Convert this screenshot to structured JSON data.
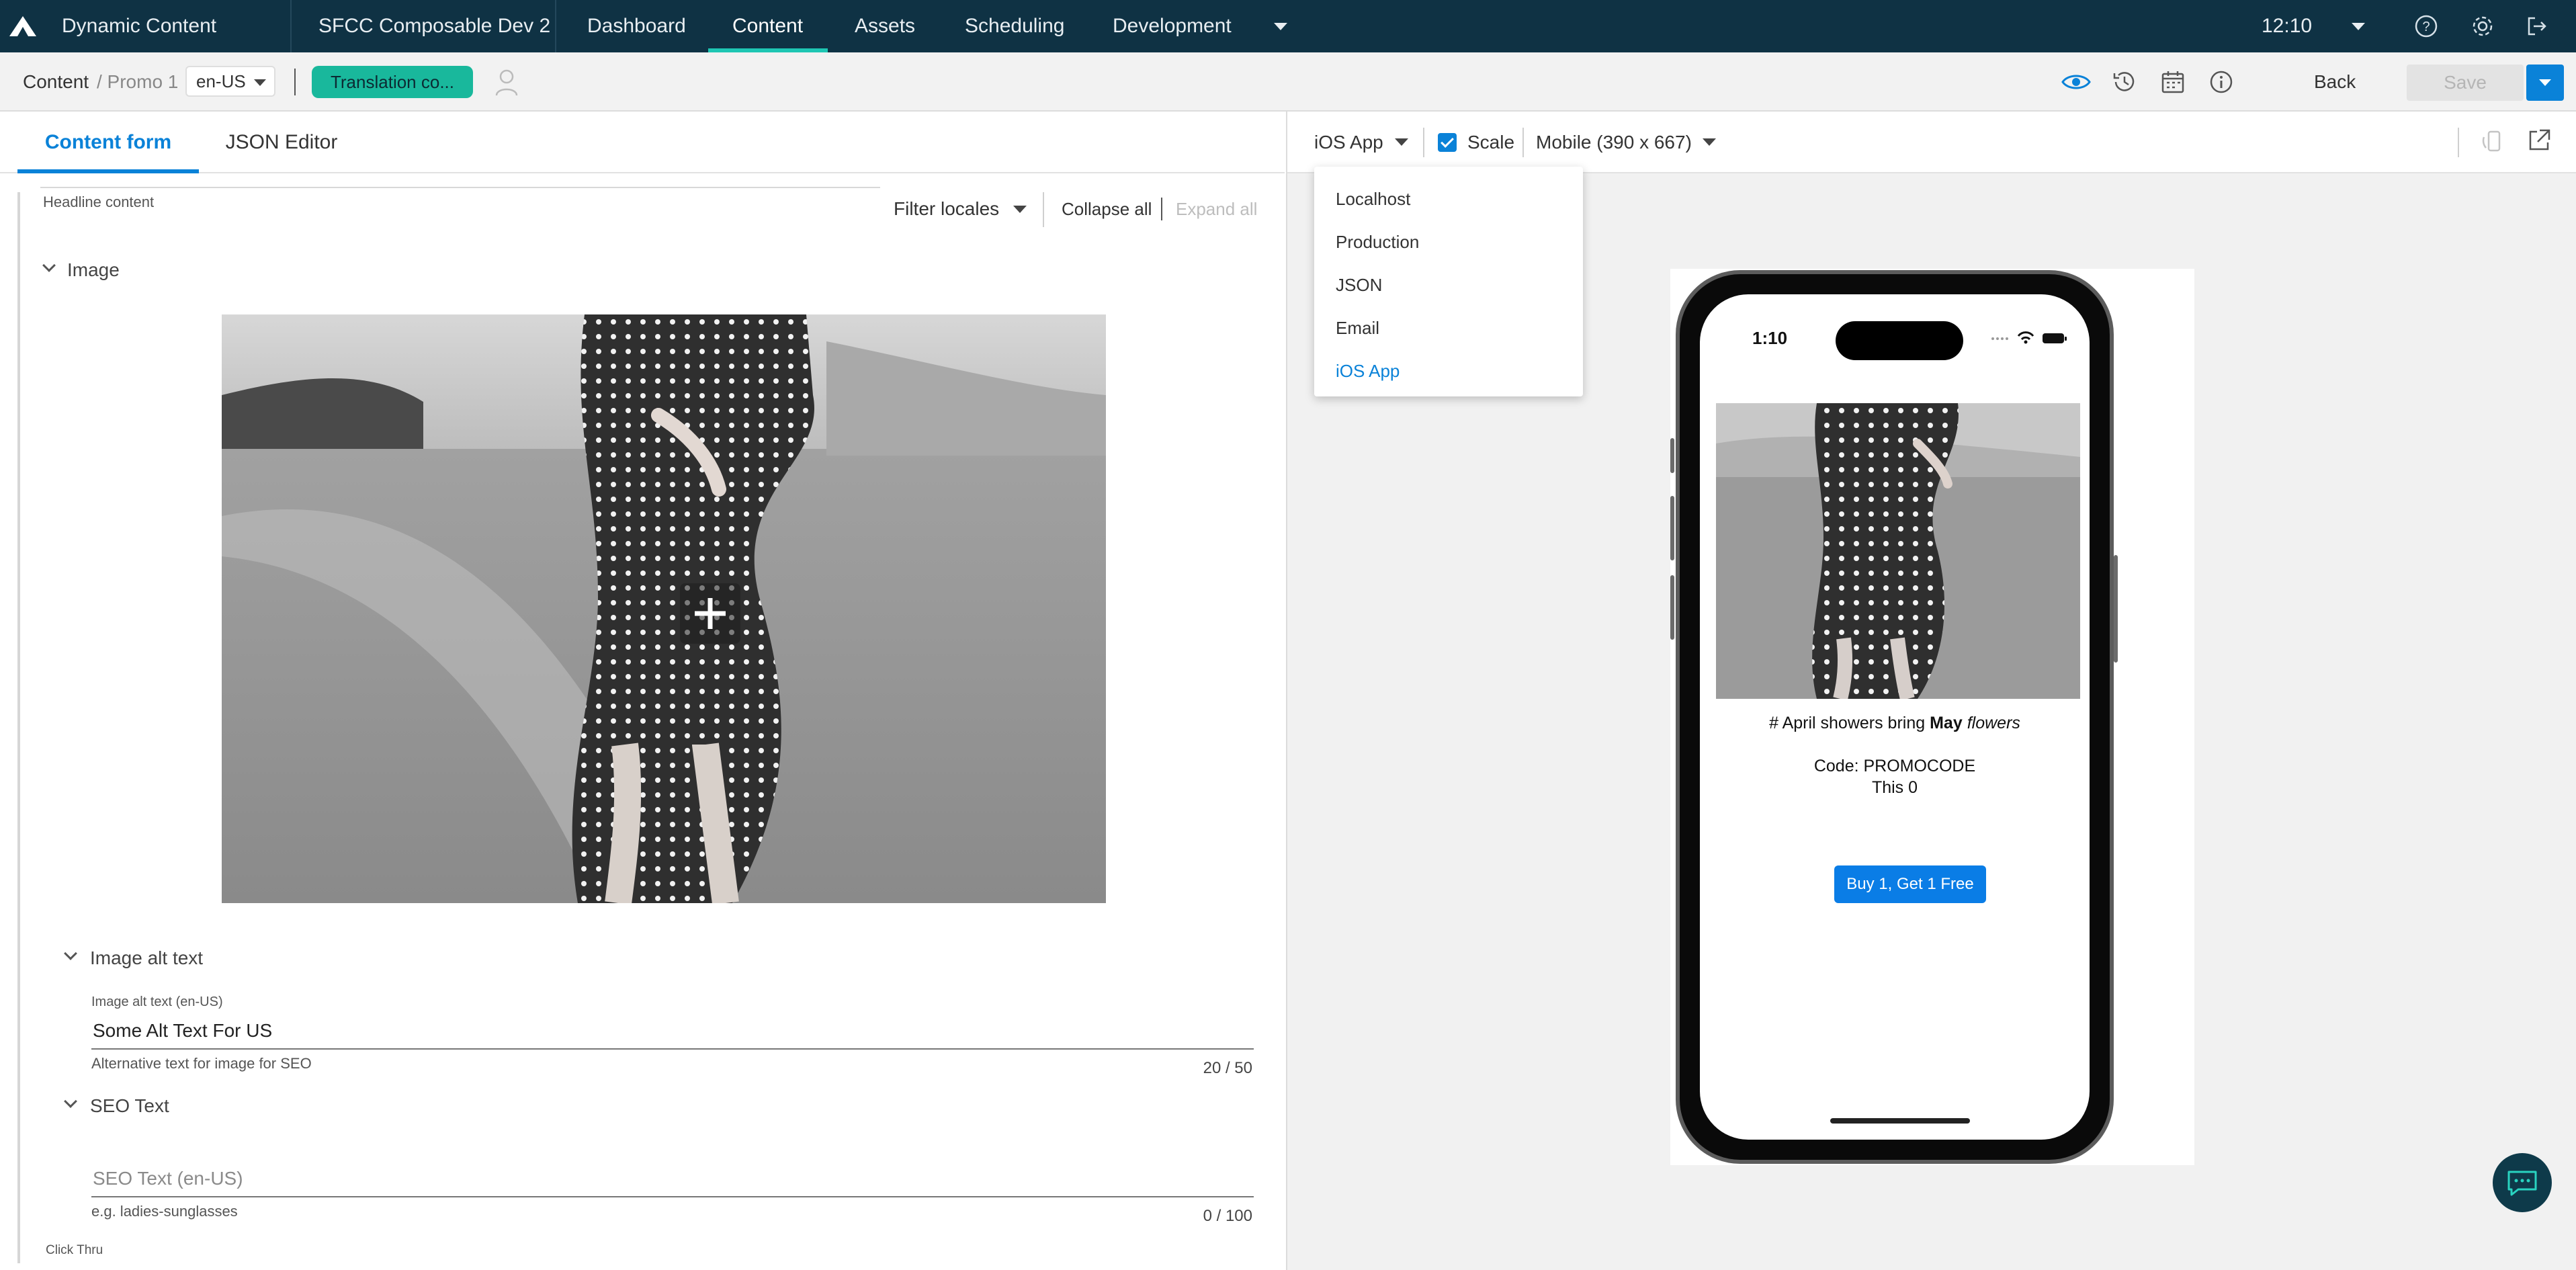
{
  "topnav": {
    "app_name": "Dynamic Content",
    "hub": "SFCC Composable Dev 2",
    "items": [
      "Dashboard",
      "Content",
      "Assets",
      "Scheduling",
      "Development"
    ],
    "active_item": "Content",
    "time": "12:10"
  },
  "toolbar": {
    "breadcrumb_root": "Content",
    "breadcrumb_item": "/ Promo 1",
    "locale": "en-US",
    "translation_badge": "Translation co...",
    "back_label": "Back",
    "save_label": "Save"
  },
  "left": {
    "tabs": [
      "Content form",
      "JSON Editor"
    ],
    "headline_label": "Headline content",
    "filter_locales": "Filter locales",
    "collapse_all": "Collapse all",
    "expand_all": "Expand all",
    "image_section": "Image",
    "alt_section": "Image alt text",
    "alt_field_label": "Image alt text (en-US)",
    "alt_value": "Some Alt Text For US",
    "alt_help": "Alternative text for image for SEO",
    "alt_counter": "20 / 50",
    "seo_section": "SEO Text",
    "seo_placeholder": "SEO Text (en-US)",
    "seo_help": "e.g. ladies-sunglasses",
    "seo_counter": "0 / 100",
    "click_thru": "Click Thru"
  },
  "preview": {
    "visualization": "iOS App",
    "scale_label": "Scale",
    "scale_checked": true,
    "device": "Mobile (390 x 667)",
    "dropdown_options": [
      "Localhost",
      "Production",
      "JSON",
      "Email",
      "iOS App"
    ],
    "selected_option": "iOS App",
    "phone": {
      "clock": "1:10",
      "headline_prefix": "# April showers bring ",
      "headline_bold": "May",
      "headline_italic": "flowers",
      "code_line": "Code: PROMOCODE",
      "this_line": "This 0",
      "button": "Buy 1, Get 1 Free"
    }
  },
  "colors": {
    "nav_bg": "#0f3244",
    "accent_teal": "#1ec6b3",
    "primary_blue": "#0a82d8",
    "badge_green": "#19b89c"
  }
}
